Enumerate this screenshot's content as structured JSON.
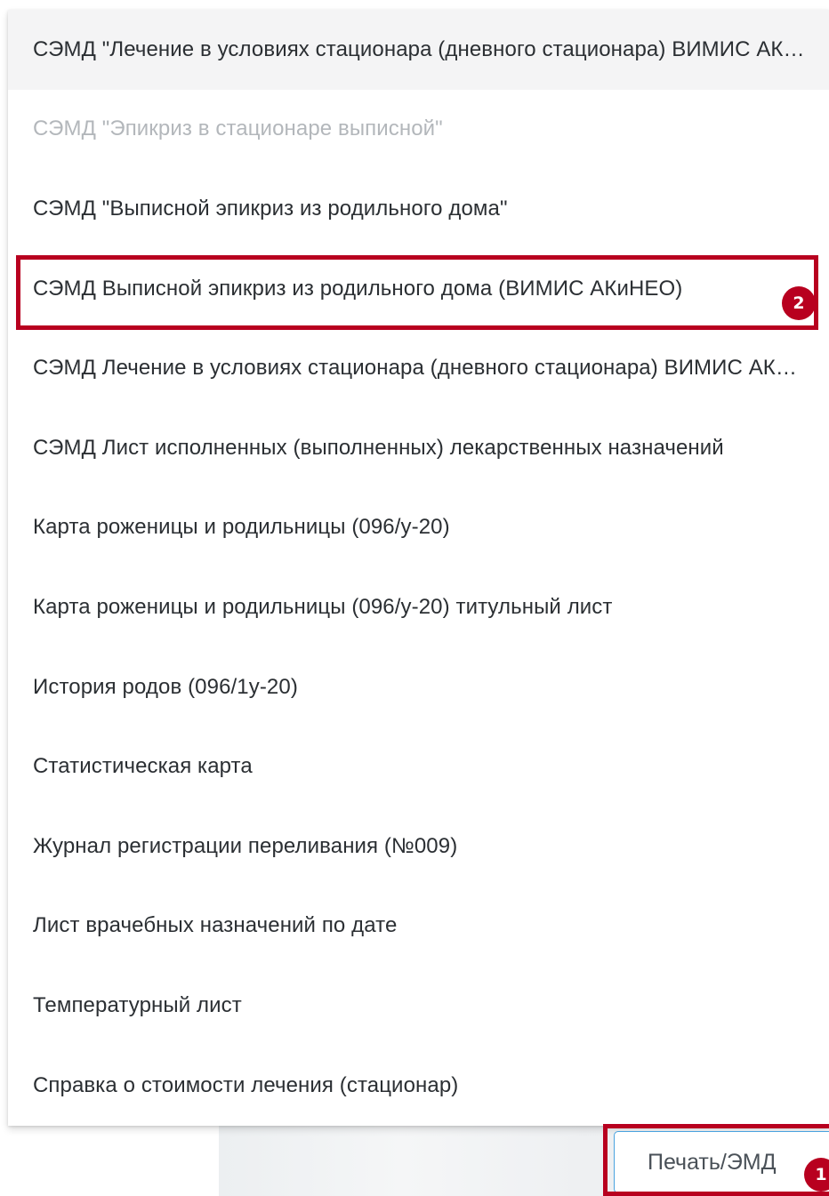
{
  "menu": {
    "items": [
      {
        "label": "СЭМД \"Лечение в условиях стационара (дневного стационара) ВИМИС АКиНЕО\"",
        "state": "hover"
      },
      {
        "label": "СЭМД \"Эпикриз в стационаре выписной\"",
        "state": "disabled"
      },
      {
        "label": "СЭМД \"Выписной эпикриз из родильного дома\"",
        "state": "normal"
      },
      {
        "label": "СЭМД Выписной эпикриз из родильного дома (ВИМИС АКиНЕО)",
        "state": "highlighted"
      },
      {
        "label": "СЭМД Лечение в условиях стационара (дневного стационара) ВИМИС АКиНЕО",
        "state": "normal"
      },
      {
        "label": "СЭМД Лист исполненных (выполненных) лекарственных назначений",
        "state": "normal"
      },
      {
        "label": "Карта роженицы и родильницы (096/у-20)",
        "state": "normal"
      },
      {
        "label": "Карта роженицы и родильницы (096/у-20) титульный лист",
        "state": "normal"
      },
      {
        "label": "История родов (096/1у-20)",
        "state": "normal"
      },
      {
        "label": "Статистическая карта",
        "state": "normal"
      },
      {
        "label": "Журнал регистрации переливания (№009)",
        "state": "normal"
      },
      {
        "label": "Лист врачебных назначений по дате",
        "state": "normal"
      },
      {
        "label": "Температурный лист",
        "state": "normal"
      },
      {
        "label": "Справка о стоимости лечения (стационар)",
        "state": "normal"
      }
    ]
  },
  "print_button": {
    "label": "Печать/ЭМД"
  },
  "annotations": {
    "step_1": "1",
    "step_2": "2"
  },
  "colors": {
    "highlight": "#b8001f",
    "button_border": "#4aa3df",
    "hover_background": "#f4f4f5",
    "disabled_text": "#b3b7bb"
  }
}
